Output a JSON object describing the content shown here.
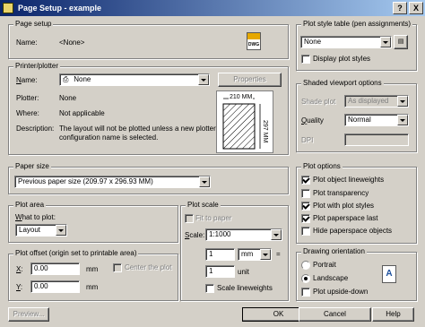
{
  "window": {
    "title": "Page Setup - example",
    "help_btn": "?",
    "close_btn": "X"
  },
  "page_setup": {
    "group": "Page setup",
    "name_label": "Name:",
    "name_value": "<None>",
    "icon": "dwg-icon",
    "icon_text": "DWG"
  },
  "printer": {
    "group": "Printer/plotter",
    "name_label": "Name:",
    "name_value": "None",
    "properties": "Properties",
    "plotter_label": "Plotter:",
    "plotter_value": "None",
    "where_label": "Where:",
    "where_value": "Not applicable",
    "desc_label": "Description:",
    "desc_line1": "The layout will not be plotted unless a new plotter",
    "desc_line2": "configuration name is selected.",
    "preview_width": "210 MM",
    "preview_height": "297 MM"
  },
  "paper_size": {
    "group": "Paper size",
    "value": "Previous paper size (209.97 x 296.93 MM)"
  },
  "plot_area": {
    "group": "Plot area",
    "what_label": "What to plot:",
    "what_value": "Layout"
  },
  "plot_offset": {
    "group": "Plot offset (origin set to printable area)",
    "x_label": "X:",
    "x_value": "0.00",
    "x_unit": "mm",
    "y_label": "Y:",
    "y_value": "0.00",
    "y_unit": "mm",
    "center": "Center the plot"
  },
  "plot_scale": {
    "group": "Plot scale",
    "fit": "Fit to paper",
    "scale_label": "Scale:",
    "scale_value": "1:1000",
    "value1": "1",
    "unit1": "mm",
    "equals": "=",
    "value2": "1",
    "unit2": "unit",
    "lineweights": "Scale lineweights"
  },
  "plot_style": {
    "group": "Plot style table (pen assignments)",
    "value": "None",
    "display": "Display plot styles"
  },
  "shaded": {
    "group": "Shaded viewport options",
    "shade_label": "Shade plot",
    "shade_value": "As displayed",
    "quality_label": "Quality",
    "quality_value": "Normal",
    "dpi_label": "DPI"
  },
  "plot_options": {
    "group": "Plot options",
    "items": [
      "Plot object lineweights",
      "Plot transparency",
      "Plot with plot styles",
      "Plot paperspace last",
      "Hide paperspace objects"
    ]
  },
  "orientation": {
    "group": "Drawing orientation",
    "portrait": "Portrait",
    "landscape": "Landscape",
    "upside": "Plot upside-down",
    "icon_text": "A"
  },
  "buttons": {
    "preview": "Preview...",
    "ok": "OK",
    "cancel": "Cancel",
    "help": "Help"
  }
}
